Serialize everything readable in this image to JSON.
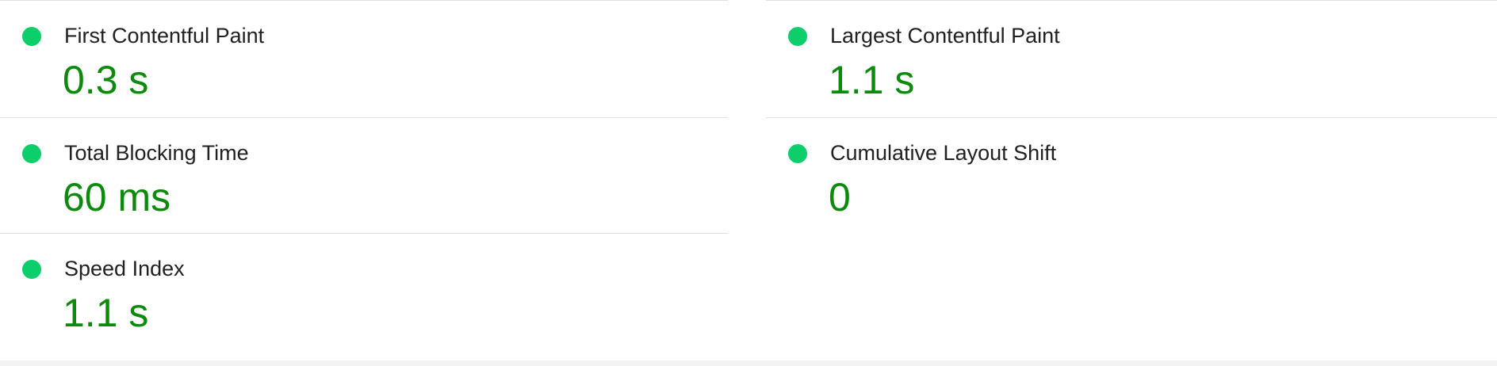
{
  "status_color": "#0cce6b",
  "value_color": "#0b8a0b",
  "metrics": {
    "left": [
      {
        "label": "First Contentful Paint",
        "value": "0.3 s",
        "status": "good",
        "icon": "circle-dot-icon"
      },
      {
        "label": "Total Blocking Time",
        "value": "60 ms",
        "status": "good",
        "icon": "circle-dot-icon"
      },
      {
        "label": "Speed Index",
        "value": "1.1 s",
        "status": "good",
        "icon": "circle-dot-icon"
      }
    ],
    "right": [
      {
        "label": "Largest Contentful Paint",
        "value": "1.1 s",
        "status": "good",
        "icon": "circle-dot-icon"
      },
      {
        "label": "Cumulative Layout Shift",
        "value": "0",
        "status": "good",
        "icon": "circle-dot-icon"
      }
    ]
  }
}
